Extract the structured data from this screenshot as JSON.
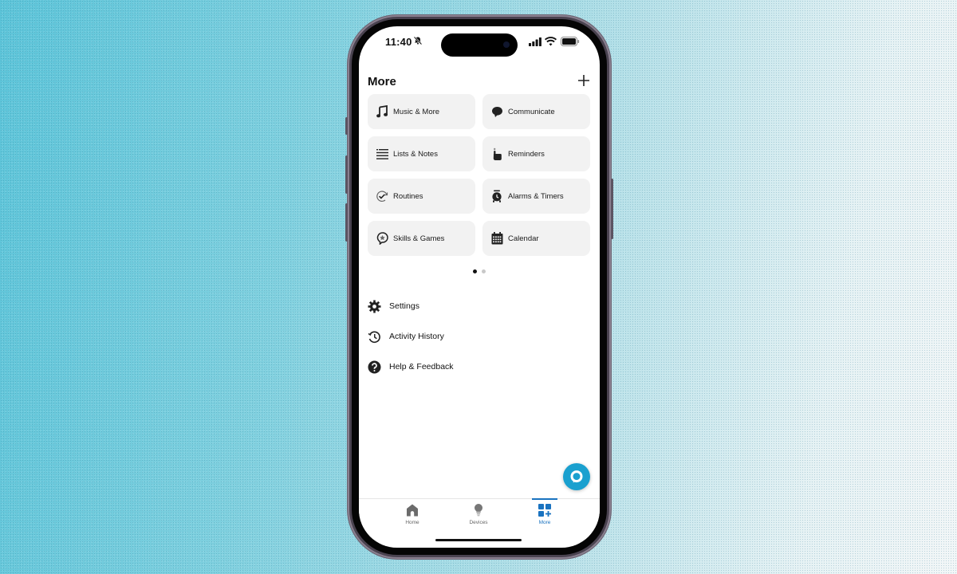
{
  "status_bar": {
    "time": "11:40",
    "icons": [
      "bell-off-icon",
      "signal-icon",
      "wifi-icon",
      "battery-icon"
    ]
  },
  "header": {
    "title": "More",
    "add_icon": "plus-icon"
  },
  "tiles": [
    {
      "label": "Music & More",
      "icon": "music-note-icon"
    },
    {
      "label": "Communicate",
      "icon": "speech-bubble-icon"
    },
    {
      "label": "Lists & Notes",
      "icon": "list-icon"
    },
    {
      "label": "Reminders",
      "icon": "finger-tap-icon"
    },
    {
      "label": "Routines",
      "icon": "routine-check-icon"
    },
    {
      "label": "Alarms & Timers",
      "icon": "alarm-clock-icon"
    },
    {
      "label": "Skills & Games",
      "icon": "skills-star-icon"
    },
    {
      "label": "Calendar",
      "icon": "calendar-icon"
    }
  ],
  "pagination": {
    "current": 1,
    "total": 2
  },
  "menu": [
    {
      "label": "Settings",
      "icon": "gear-icon"
    },
    {
      "label": "Activity History",
      "icon": "history-icon"
    },
    {
      "label": "Help & Feedback",
      "icon": "help-icon"
    }
  ],
  "tabbar": {
    "tabs": [
      {
        "label": "Home",
        "icon": "home-icon",
        "active": false
      },
      {
        "label": "Devices",
        "icon": "lightbulb-icon",
        "active": false
      },
      {
        "label": "More",
        "icon": "more-grid-icon",
        "active": true
      }
    ]
  },
  "colors": {
    "accent": "#1a73c0",
    "alexa_button": "#1aa0cf",
    "tile_bg": "#f2f2f2"
  }
}
